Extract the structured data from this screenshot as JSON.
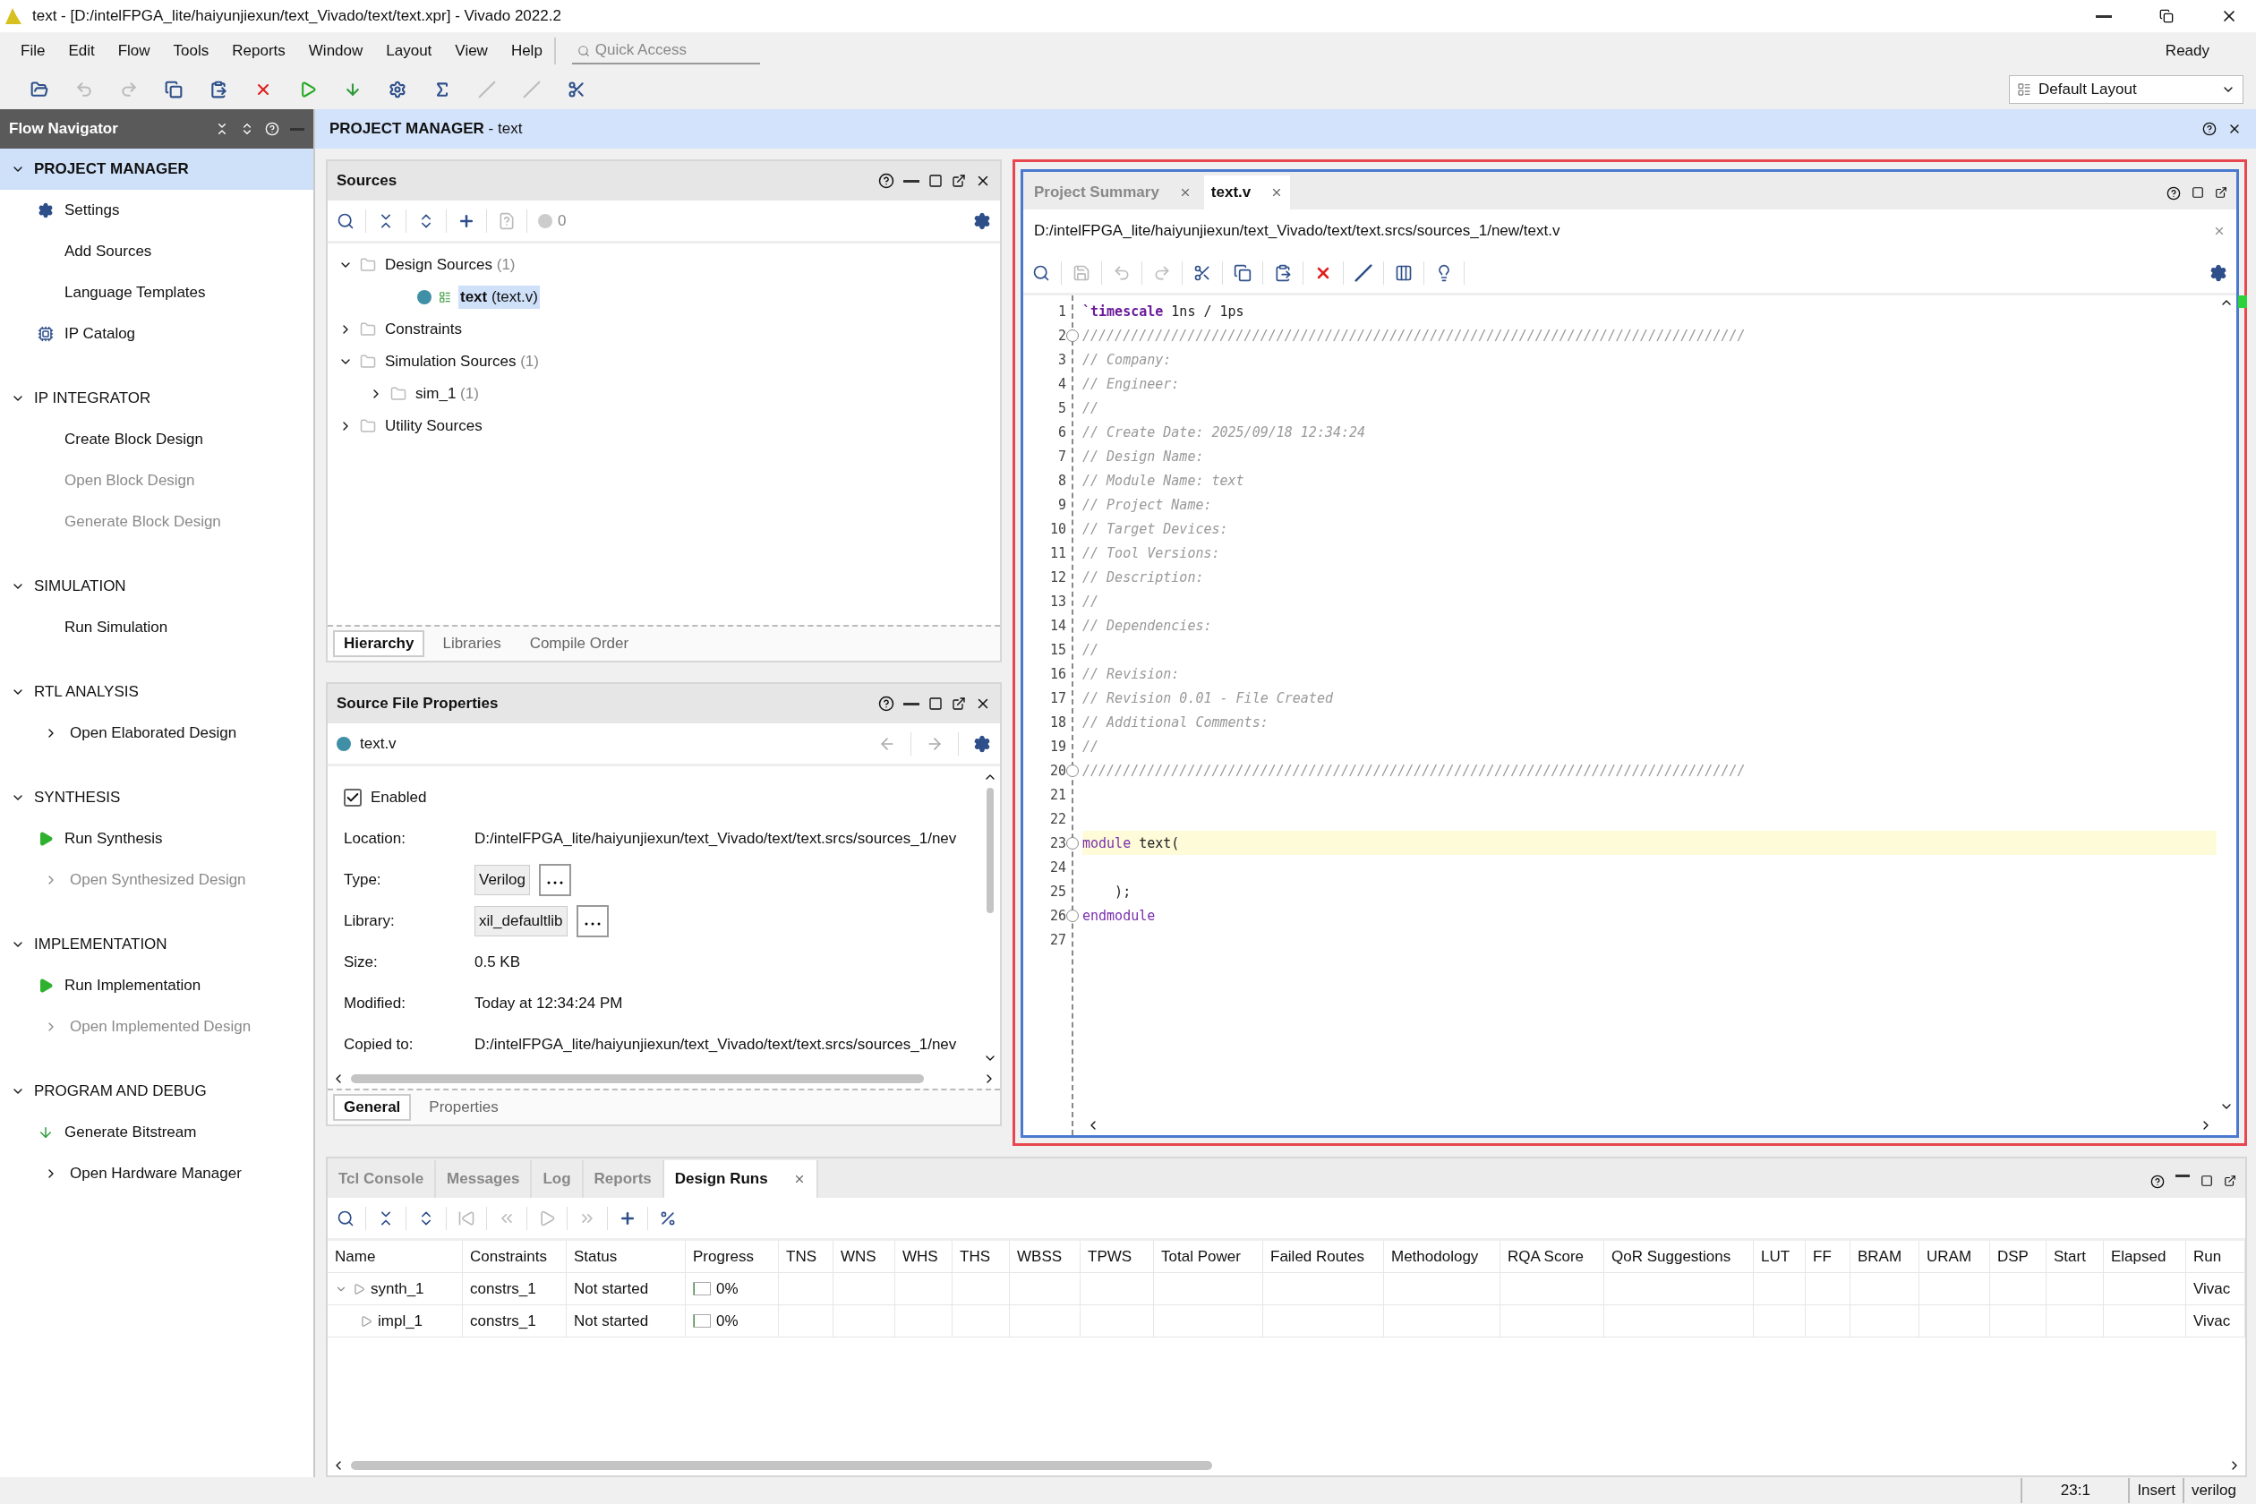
{
  "window": {
    "title": "text - [D:/intelFPGA_lite/haiyunjiexun/text_Vivado/text/text.xpr] - Vivado 2022.2",
    "status": "Ready"
  },
  "menu": [
    {
      "label": "File"
    },
    {
      "label": "Edit"
    },
    {
      "label": "Flow"
    },
    {
      "label": "Tools"
    },
    {
      "label": "Reports"
    },
    {
      "label": "Window"
    },
    {
      "label": "Layout"
    },
    {
      "label": "View"
    },
    {
      "label": "Help"
    }
  ],
  "quick_access": {
    "placeholder": "Quick Access"
  },
  "toolbar": [
    {
      "disabled": false
    },
    {
      "disabled": true
    },
    {
      "disabled": true
    },
    {
      "disabled": false
    },
    {
      "disabled": false
    },
    {
      "disabled": false
    },
    {
      "disabled": false
    },
    {
      "disabled": false
    },
    {
      "disabled": false
    },
    {
      "disabled": false
    },
    {
      "disabled": true
    },
    {
      "disabled": true
    },
    {
      "disabled": false
    }
  ],
  "layout_select": {
    "value": "Default Layout"
  },
  "flow_navigator": {
    "title": "Flow Navigator",
    "sections": [
      {
        "title": "PROJECT MANAGER",
        "expanded": true,
        "selected": true,
        "items": [
          {
            "label": "Settings",
            "kind": "settings",
            "disabled": false
          },
          {
            "label": "Add Sources",
            "kind": "plain",
            "disabled": false
          },
          {
            "label": "Language Templates",
            "kind": "plain",
            "disabled": false
          },
          {
            "label": "IP Catalog",
            "kind": "catalog",
            "disabled": false
          }
        ]
      },
      {
        "title": "IP INTEGRATOR",
        "expanded": true,
        "selected": false,
        "items": [
          {
            "label": "Create Block Design",
            "kind": "plain",
            "disabled": false
          },
          {
            "label": "Open Block Design",
            "kind": "plain",
            "disabled": true
          },
          {
            "label": "Generate Block Design",
            "kind": "plain",
            "disabled": true
          }
        ]
      },
      {
        "title": "SIMULATION",
        "expanded": true,
        "selected": false,
        "items": [
          {
            "label": "Run Simulation",
            "kind": "plain",
            "disabled": false
          }
        ]
      },
      {
        "title": "RTL ANALYSIS",
        "expanded": true,
        "selected": false,
        "items": [
          {
            "label": "Open Elaborated Design",
            "kind": "submenu",
            "disabled": false
          }
        ]
      },
      {
        "title": "SYNTHESIS",
        "expanded": true,
        "selected": false,
        "items": [
          {
            "label": "Run Synthesis",
            "kind": "run",
            "disabled": false
          },
          {
            "label": "Open Synthesized Design",
            "kind": "submenu",
            "disabled": true
          }
        ]
      },
      {
        "title": "IMPLEMENTATION",
        "expanded": true,
        "selected": false,
        "items": [
          {
            "label": "Run Implementation",
            "kind": "run",
            "disabled": false
          },
          {
            "label": "Open Implemented Design",
            "kind": "submenu",
            "disabled": true
          }
        ]
      },
      {
        "title": "PROGRAM AND DEBUG",
        "expanded": true,
        "selected": false,
        "items": [
          {
            "label": "Generate Bitstream",
            "kind": "bitstream",
            "disabled": false
          },
          {
            "label": "Open Hardware Manager",
            "kind": "submenu",
            "disabled": false
          }
        ]
      }
    ]
  },
  "header": {
    "title": "PROJECT MANAGER",
    "subtitle": "- text"
  },
  "sources": {
    "title": "Sources",
    "warning_count": "0",
    "tree": [
      {
        "label": "Design Sources",
        "count": "(1)",
        "kind": "folder",
        "expanded": true,
        "selected": false,
        "children": [
          {
            "label": "text",
            "detail": "(text.v)",
            "kind": "module",
            "selected": true
          }
        ]
      },
      {
        "label": "Constraints",
        "kind": "folder",
        "expanded": false,
        "selected": false
      },
      {
        "label": "Simulation Sources",
        "count": "(1)",
        "kind": "folder",
        "expanded": true,
        "selected": false,
        "children": [
          {
            "label": "sim_1",
            "count": "(1)",
            "kind": "folder",
            "expanded": false,
            "selected": false
          }
        ]
      },
      {
        "label": "Utility Sources",
        "kind": "folder",
        "expanded": false,
        "selected": false
      }
    ],
    "tabs": [
      {
        "label": "Hierarchy",
        "selected": true
      },
      {
        "label": "Libraries",
        "selected": false
      },
      {
        "label": "Compile Order",
        "selected": false
      }
    ]
  },
  "properties": {
    "title": "Source File Properties",
    "file": "text.v",
    "enabled": {
      "label": "Enabled",
      "checked": true
    },
    "rows": [
      {
        "label": "Location:",
        "value": "D:/intelFPGA_lite/haiyunjiexun/text_Vivado/text/text.srcs/sources_1/nev",
        "kind": "text"
      },
      {
        "label": "Type:",
        "value": "Verilog",
        "kind": "select"
      },
      {
        "label": "Library:",
        "value": "xil_defaultlib",
        "kind": "select"
      },
      {
        "label": "Size:",
        "value": "0.5 KB",
        "kind": "text"
      },
      {
        "label": "Modified:",
        "value": "Today at 12:34:24 PM",
        "kind": "text"
      },
      {
        "label": "Copied to:",
        "value": "D:/intelFPGA_lite/haiyunjiexun/text_Vivado/text/text.srcs/sources_1/nev",
        "kind": "text"
      }
    ],
    "tabs": [
      {
        "label": "General",
        "selected": true
      },
      {
        "label": "Properties",
        "selected": false
      }
    ]
  },
  "editor": {
    "tabs": [
      {
        "label": "Project Summary",
        "selected": false
      },
      {
        "label": "text.v",
        "selected": true
      }
    ],
    "path": "D:/intelFPGA_lite/haiyunjiexun/text_Vivado/text/text.srcs/sources_1/new/text.v",
    "lines": [
      {
        "number": "1",
        "fold": false,
        "segments": [
          {
            "text": "`timescale",
            "kind": "directive"
          },
          {
            "text": " 1ns / 1ps",
            "kind": "plain"
          }
        ]
      },
      {
        "number": "2",
        "fold": true,
        "segments": [
          {
            "text": "//////////////////////////////////////////////////////////////////////////////////",
            "kind": "comment"
          }
        ]
      },
      {
        "number": "3",
        "fold": false,
        "segments": [
          {
            "text": "// Company:",
            "kind": "comment"
          }
        ]
      },
      {
        "number": "4",
        "fold": false,
        "segments": [
          {
            "text": "// Engineer:",
            "kind": "comment"
          }
        ]
      },
      {
        "number": "5",
        "fold": false,
        "segments": [
          {
            "text": "//",
            "kind": "comment"
          }
        ]
      },
      {
        "number": "6",
        "fold": false,
        "segments": [
          {
            "text": "// Create Date: 2025/09/18 12:34:24",
            "kind": "comment"
          }
        ]
      },
      {
        "number": "7",
        "fold": false,
        "segments": [
          {
            "text": "// Design Name:",
            "kind": "comment"
          }
        ]
      },
      {
        "number": "8",
        "fold": false,
        "segments": [
          {
            "text": "// Module Name: text",
            "kind": "comment"
          }
        ]
      },
      {
        "number": "9",
        "fold": false,
        "segments": [
          {
            "text": "// Project Name:",
            "kind": "comment"
          }
        ]
      },
      {
        "number": "10",
        "fold": false,
        "segments": [
          {
            "text": "// Target Devices:",
            "kind": "comment"
          }
        ]
      },
      {
        "number": "11",
        "fold": false,
        "segments": [
          {
            "text": "// Tool Versions:",
            "kind": "comment"
          }
        ]
      },
      {
        "number": "12",
        "fold": false,
        "segments": [
          {
            "text": "// Description:",
            "kind": "comment"
          }
        ]
      },
      {
        "number": "13",
        "fold": false,
        "segments": [
          {
            "text": "//",
            "kind": "comment"
          }
        ]
      },
      {
        "number": "14",
        "fold": false,
        "segments": [
          {
            "text": "// Dependencies:",
            "kind": "comment"
          }
        ]
      },
      {
        "number": "15",
        "fold": false,
        "segments": [
          {
            "text": "//",
            "kind": "comment"
          }
        ]
      },
      {
        "number": "16",
        "fold": false,
        "segments": [
          {
            "text": "// Revision:",
            "kind": "comment"
          }
        ]
      },
      {
        "number": "17",
        "fold": false,
        "segments": [
          {
            "text": "// Revision 0.01 - File Created",
            "kind": "comment"
          }
        ]
      },
      {
        "number": "18",
        "fold": false,
        "segments": [
          {
            "text": "// Additional Comments:",
            "kind": "comment"
          }
        ]
      },
      {
        "number": "19",
        "fold": false,
        "segments": [
          {
            "text": "//",
            "kind": "comment"
          }
        ]
      },
      {
        "number": "20",
        "fold": true,
        "segments": [
          {
            "text": "//////////////////////////////////////////////////////////////////////////////////",
            "kind": "comment"
          }
        ]
      },
      {
        "number": "21",
        "fold": false
      },
      {
        "number": "22",
        "fold": false
      },
      {
        "number": "23",
        "fold": true,
        "current": true,
        "segments": [
          {
            "text": "module",
            "kind": "keyword"
          },
          {
            "text": " text(",
            "kind": "plain"
          }
        ]
      },
      {
        "number": "24",
        "fold": false
      },
      {
        "number": "25",
        "fold": false,
        "segments": [
          {
            "text": "    );",
            "kind": "plain"
          }
        ]
      },
      {
        "number": "26",
        "fold": true,
        "segments": [
          {
            "text": "endmodule",
            "kind": "keyword"
          }
        ]
      },
      {
        "number": "27",
        "fold": false
      }
    ]
  },
  "bottom_panel": {
    "tabs": [
      {
        "label": "Tcl Console",
        "selected": false,
        "closable": false
      },
      {
        "label": "Messages",
        "selected": false,
        "closable": false
      },
      {
        "label": "Log",
        "selected": false,
        "closable": false
      },
      {
        "label": "Reports",
        "selected": false,
        "closable": false
      },
      {
        "label": "Design Runs",
        "selected": true,
        "closable": true
      }
    ],
    "table": {
      "columns": [
        "Name",
        "Constraints",
        "Status",
        "Progress",
        "TNS",
        "WNS",
        "WHS",
        "THS",
        "WBSS",
        "TPWS",
        "Total Power",
        "Failed Routes",
        "Methodology",
        "RQA Score",
        "QoR Suggestions",
        "LUT",
        "FF",
        "BRAM",
        "URAM",
        "DSP",
        "Start",
        "Elapsed",
        "Run"
      ],
      "rows": [
        {
          "name": "synth_1",
          "expanded": true,
          "constraints": "constrs_1",
          "status": "Not started",
          "progress": {
            "level": 0,
            "text": "0%"
          },
          "run": "Vivac",
          "children": [
            {
              "name": "impl_1",
              "constraints": "constrs_1",
              "status": "Not started",
              "progress": {
                "level": 0,
                "text": "0%"
              },
              "run": "Vivac"
            }
          ]
        }
      ]
    }
  },
  "status_bar": {
    "position": "23:1",
    "mode": "Insert",
    "language": "verilog"
  }
}
